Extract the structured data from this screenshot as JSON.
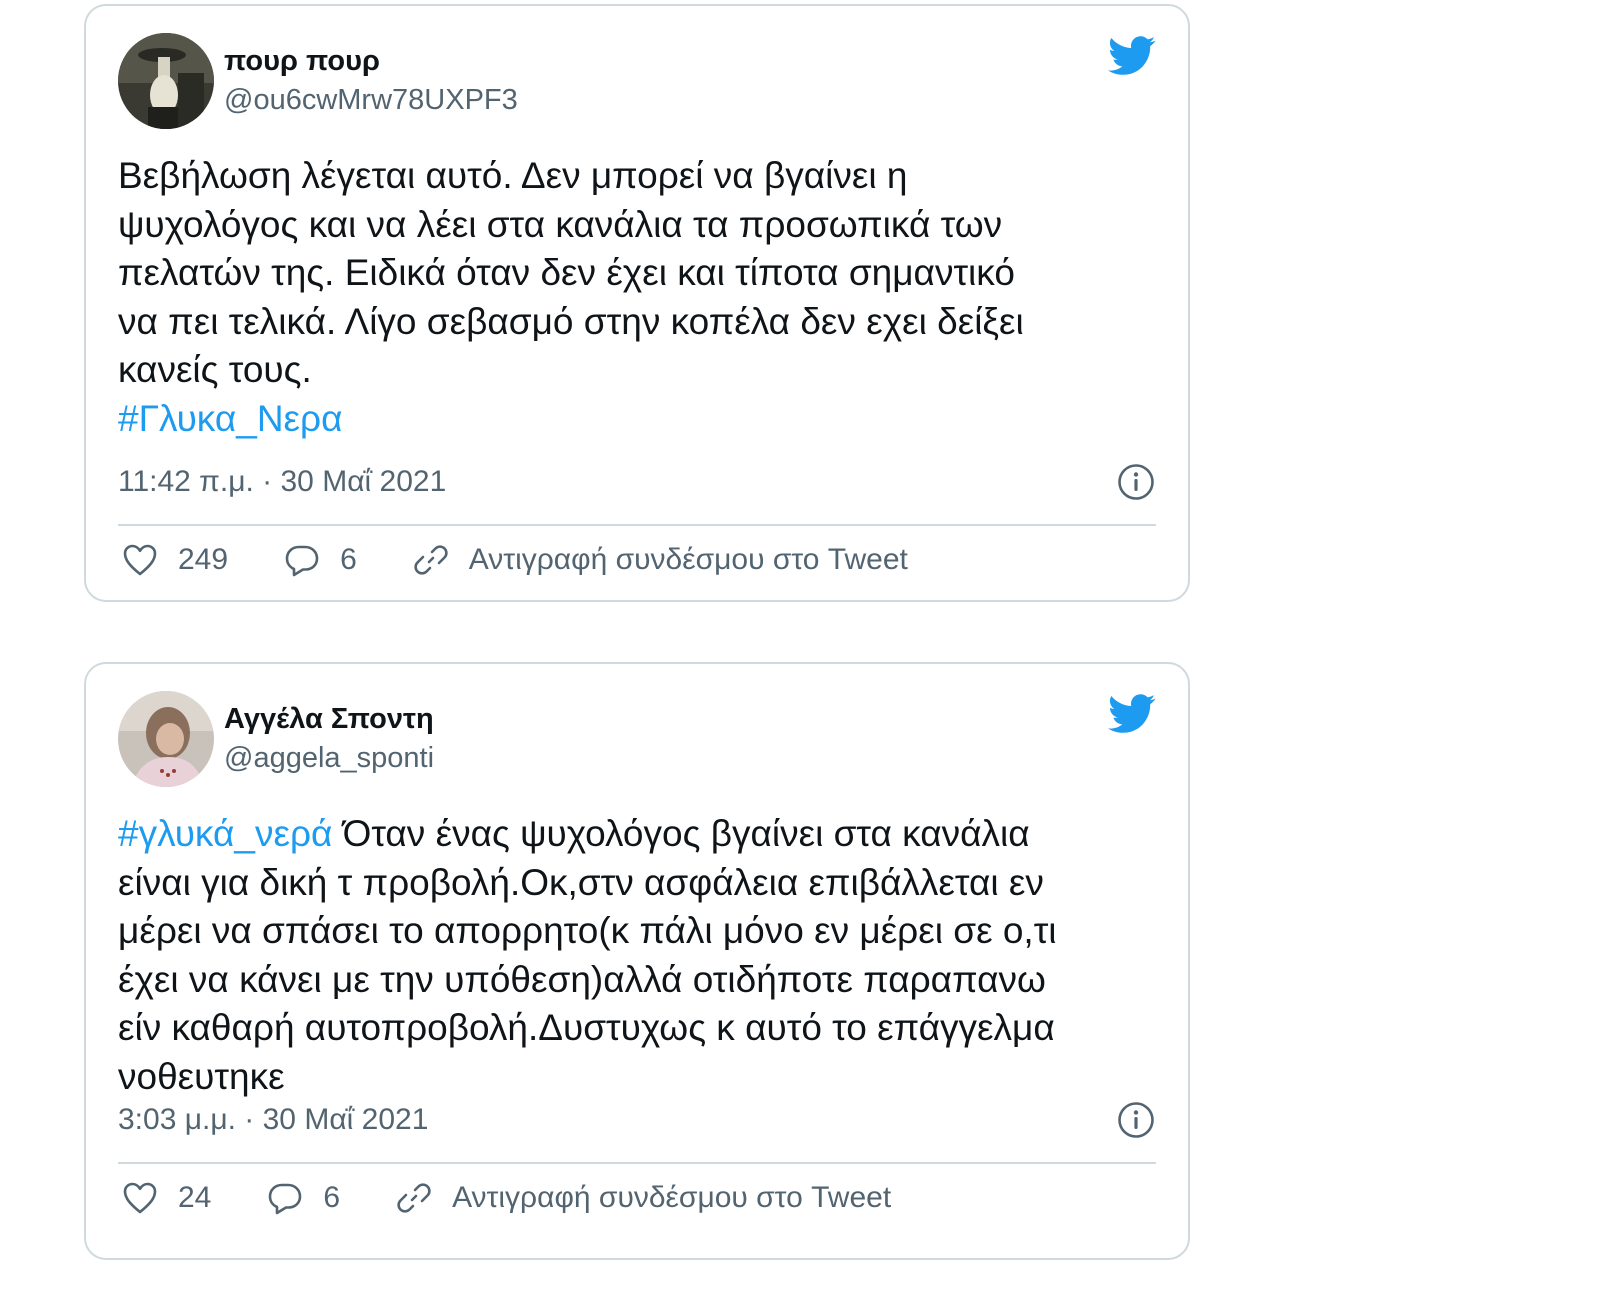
{
  "colors": {
    "link": "#1d9bf0",
    "text": "#0f1419",
    "secondary": "#536471",
    "border": "#cfd9de"
  },
  "tweets": [
    {
      "display_name": "πουρ πουρ",
      "handle": "@ou6cwMrw78UXPF3",
      "text_lines": [
        "Βεβήλωση λέγεται αυτό. Δεν μπορεί να βγαίνει η",
        "ψυχολόγος και να λέει στα κανάλια τα προσωπικά των",
        "πελατών της. Ειδικά όταν δεν έχει και τίποτα σημαντικό",
        "να πει τελικά. Λίγο σεβασμό στην κοπέλα δεν εχει δείξει",
        "κανείς τους."
      ],
      "hashtag": "#Γλυκα_Νερα",
      "timestamp": "11:42 π.μ. · 30 Μαΐ 2021",
      "likes": "249",
      "replies": "6",
      "copy_link_label": "Αντιγραφή συνδέσμου στο Tweet",
      "icons": [
        "twitter-bird-icon",
        "info-icon",
        "heart-icon",
        "reply-icon",
        "link-icon"
      ]
    },
    {
      "display_name": "Αγγέλα Σποντη",
      "handle": "@aggela_sponti",
      "hashtag": "#γλυκά_νερά",
      "first_line_rest": " Όταν ένας ψυχολόγος βγαίνει στα κανάλια",
      "text_lines": [
        "είναι για δική τ προβολή.Οκ,στν ασφάλεια επιβάλλεται εν",
        "μέρει να σπάσει το απορρητο(κ πάλι μόνο εν μέρει σε ο,τι",
        "έχει να κάνει με την υπόθεση)αλλά οτιδήποτε παραπανω",
        "είν καθαρή αυτοπροβολή.Δυστυχως κ αυτό το επάγγελμα",
        "νοθευτηκε"
      ],
      "timestamp": "3:03 μ.μ. · 30 Μαΐ 2021",
      "likes": "24",
      "replies": "6",
      "copy_link_label": "Αντιγραφή συνδέσμου στο Tweet",
      "icons": [
        "twitter-bird-icon",
        "info-icon",
        "heart-icon",
        "reply-icon",
        "link-icon"
      ]
    }
  ]
}
